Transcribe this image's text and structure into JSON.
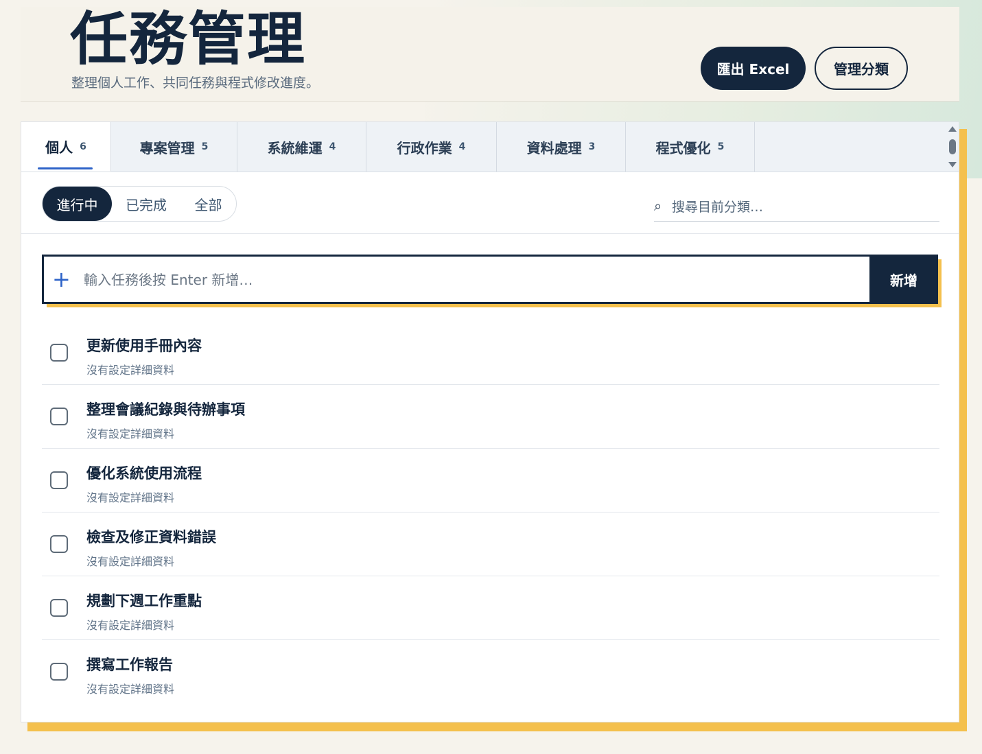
{
  "header": {
    "title": "任務管理",
    "subtitle": "整理個人工作、共同任務與程式修改進度。",
    "export_label": "匯出 Excel",
    "manage_label": "管理分類"
  },
  "tabs": [
    {
      "label": "個人",
      "count": "6",
      "active": true
    },
    {
      "label": "專案管理",
      "count": "5"
    },
    {
      "label": "系統維運",
      "count": "4"
    },
    {
      "label": "行政作業",
      "count": "4"
    },
    {
      "label": "資料處理",
      "count": "3"
    },
    {
      "label": "程式優化",
      "count": "5"
    }
  ],
  "filters": {
    "in_progress": "進行中",
    "completed": "已完成",
    "all": "全部",
    "active": "進行中"
  },
  "search": {
    "icon": "search-icon",
    "placeholder": "搜尋目前分類…"
  },
  "add": {
    "icon": "plus-icon",
    "placeholder": "輸入任務後按 Enter 新增…",
    "button_label": "新增"
  },
  "tasks": [
    {
      "title": "更新使用手冊內容",
      "detail": "沒有設定詳細資料",
      "done": false
    },
    {
      "title": "整理會議紀錄與待辦事項",
      "detail": "沒有設定詳細資料",
      "done": false
    },
    {
      "title": "優化系統使用流程",
      "detail": "沒有設定詳細資料",
      "done": false
    },
    {
      "title": "檢查及修正資料錯誤",
      "detail": "沒有設定詳細資料",
      "done": false
    },
    {
      "title": "規劃下週工作重點",
      "detail": "沒有設定詳細資料",
      "done": false
    },
    {
      "title": "撰寫工作報告",
      "detail": "沒有設定詳細資料",
      "done": false
    }
  ],
  "colors": {
    "primary": "#14263d",
    "accent_shadow": "#f4c04d",
    "tab_underline": "#2d63c8",
    "background": "#f6f3ec"
  }
}
